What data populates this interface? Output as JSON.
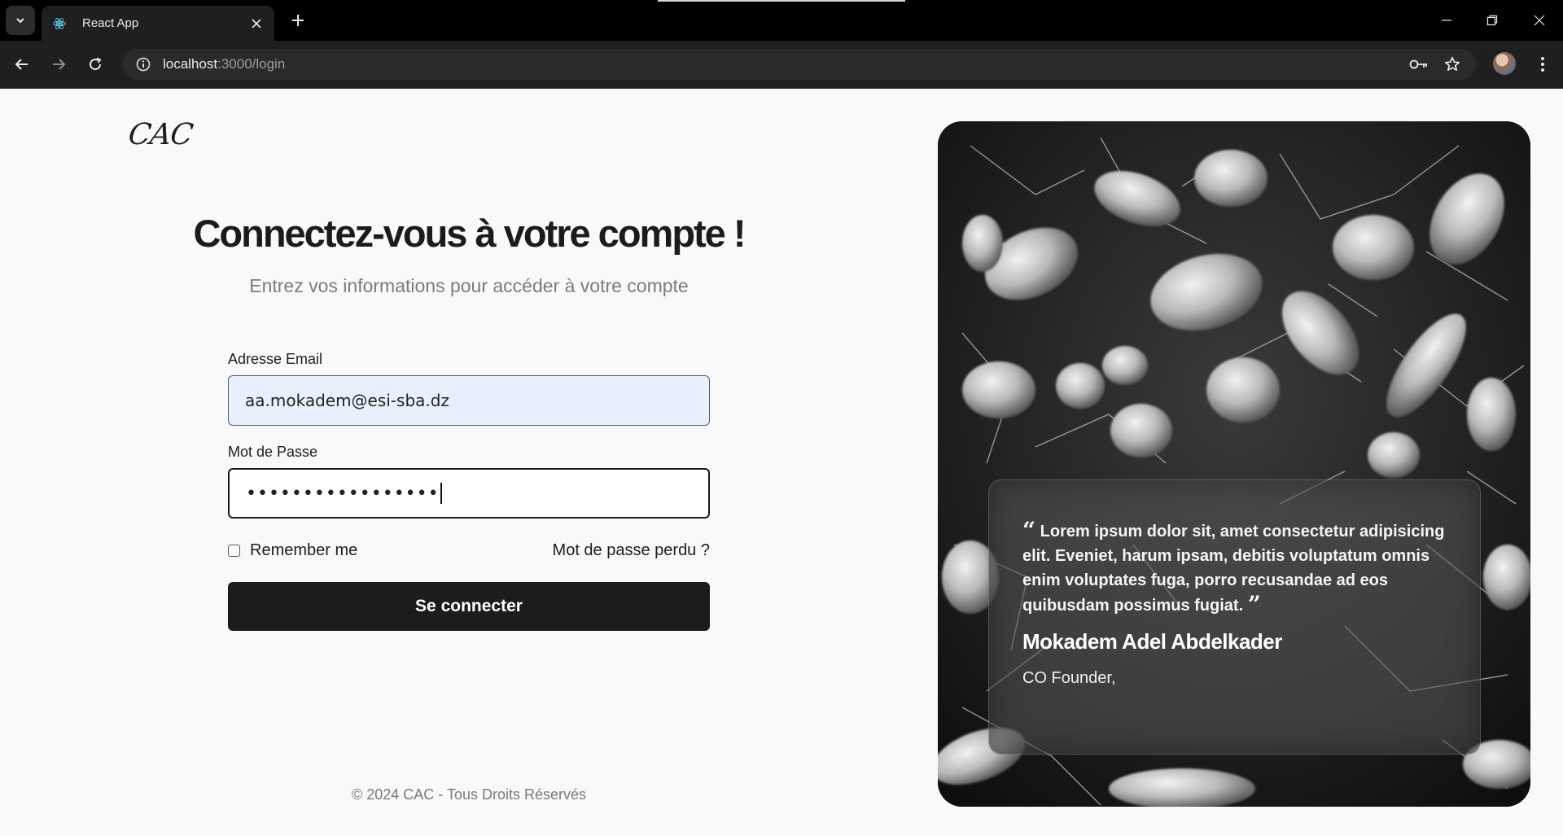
{
  "browser": {
    "tab_title": "React App",
    "url_host": "localhost",
    "url_path": ":3000/login"
  },
  "page": {
    "logo": "CAC",
    "heading": "Connectez-vous à votre compte !",
    "subheading": "Entrez vos informations pour accéder à votre compte",
    "form": {
      "email_label": "Adresse Email",
      "email_value": "aa.mokadem@esi-sba.dz",
      "password_label": "Mot de Passe",
      "password_mask": "•••••••••••••••••",
      "remember_label": "Remember me",
      "forgot_label": "Mot de passe perdu ?",
      "submit_label": "Se connecter"
    },
    "footer": "© 2024 CAC - Tous Droits Réservés",
    "testimonial": {
      "quote": "Lorem ipsum dolor sit, amet consectetur adipisicing elit. Eveniet, harum ipsam, debitis voluptatum omnis enim voluptates fuga, porro recusandae ad eos quibusdam possimus fugiat.",
      "open_mark": "“",
      "close_mark": "”",
      "author": "Mokadem Adel Abdelkader",
      "role": "CO Founder,"
    }
  },
  "colors": {
    "button_bg": "#1c1c1c",
    "email_autofill_bg": "#e8f0fe",
    "page_bg": "#f8f9fa"
  },
  "icons": [
    "tab-list-icon",
    "react-logo-icon",
    "close-icon",
    "plus-icon",
    "minimize-icon",
    "restore-icon",
    "back-icon",
    "forward-icon",
    "reload-icon",
    "site-info-icon",
    "password-key-icon",
    "star-icon",
    "kebab-menu-icon"
  ]
}
